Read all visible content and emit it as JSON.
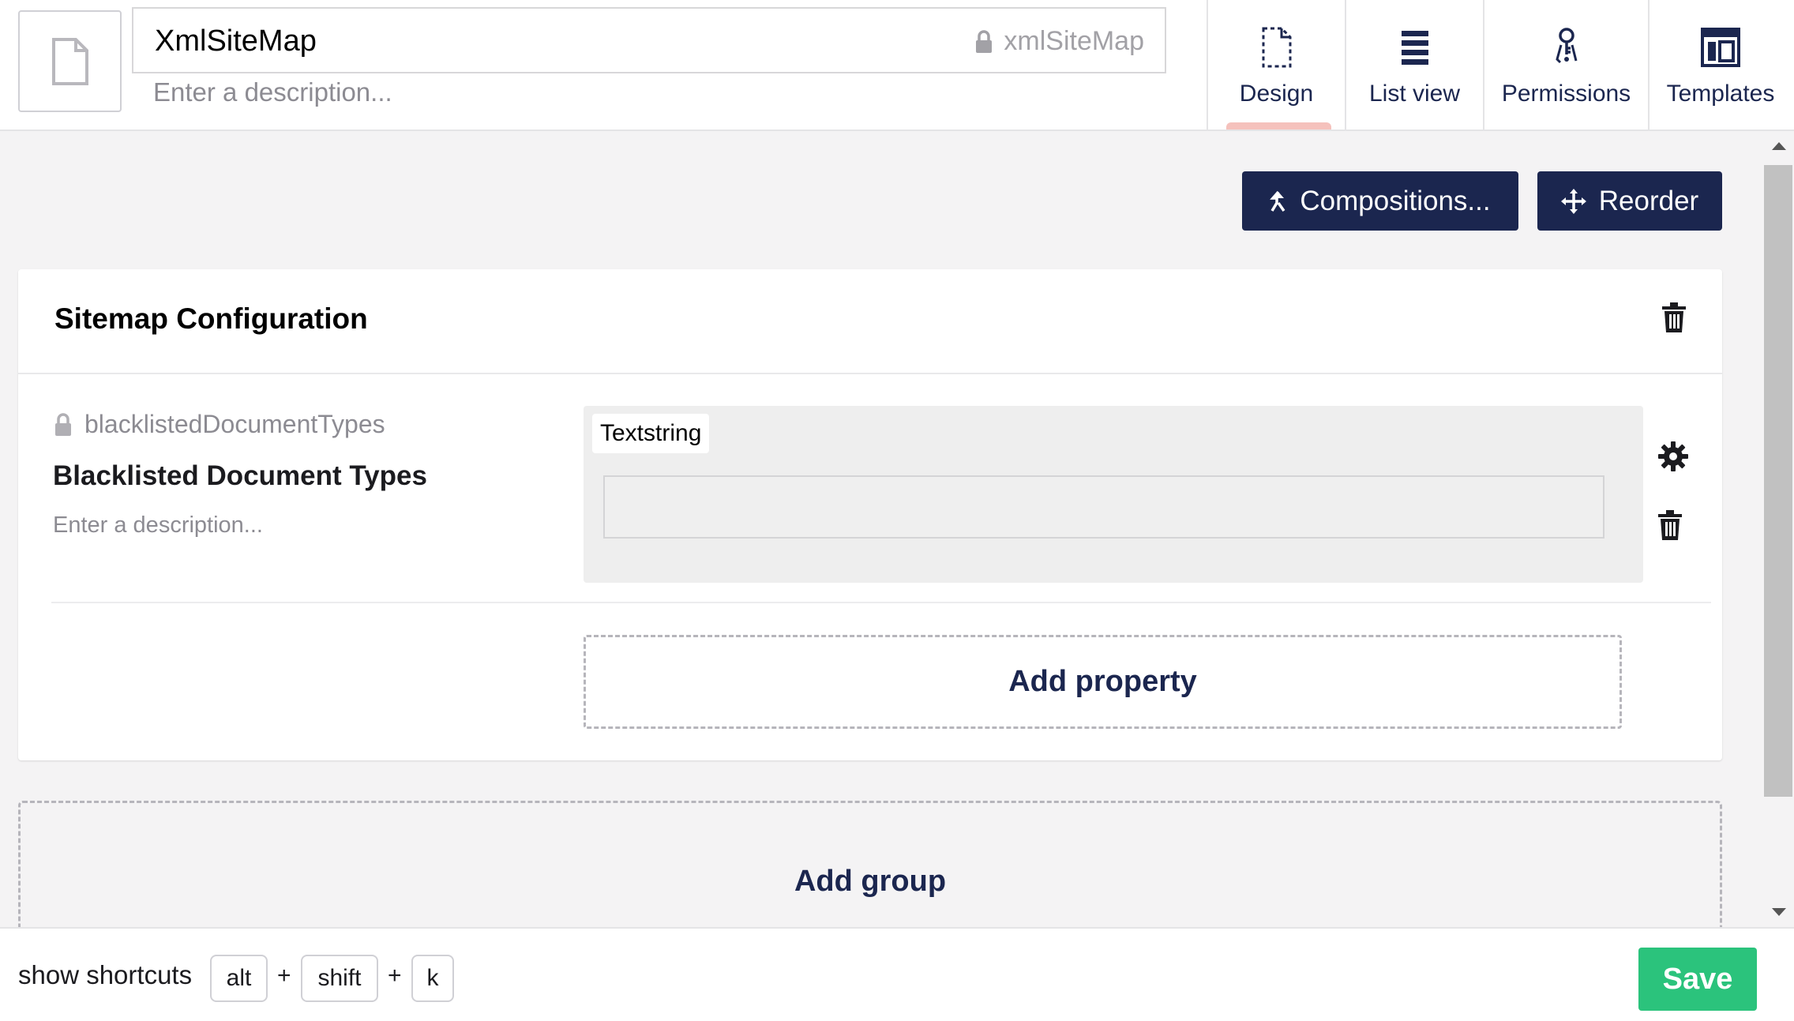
{
  "header": {
    "name": "XmlSiteMap",
    "alias": "xmlSiteMap",
    "description_placeholder": "Enter a description..."
  },
  "tabs": [
    {
      "label": "Design",
      "icon": "document-dashed-icon",
      "active": true
    },
    {
      "label": "List view",
      "icon": "list-icon"
    },
    {
      "label": "Permissions",
      "icon": "keys-icon"
    },
    {
      "label": "Templates",
      "icon": "layout-icon"
    }
  ],
  "toolbar": {
    "compositions_label": "Compositions...",
    "reorder_label": "Reorder"
  },
  "group": {
    "title": "Sitemap Configuration",
    "property": {
      "alias": "blacklistedDocumentTypes",
      "name": "Blacklisted Document Types",
      "description_placeholder": "Enter a description...",
      "editor": "Textstring"
    },
    "add_property_label": "Add property"
  },
  "add_group_label": "Add group",
  "footer": {
    "shortcuts_label": "show shortcuts",
    "keys": [
      "alt",
      "shift",
      "k"
    ],
    "plus": "+",
    "save_label": "Save"
  },
  "colors": {
    "primary": "#1b264f",
    "save": "#2bc37c",
    "active_tab_indicator": "#f5c1bc"
  }
}
